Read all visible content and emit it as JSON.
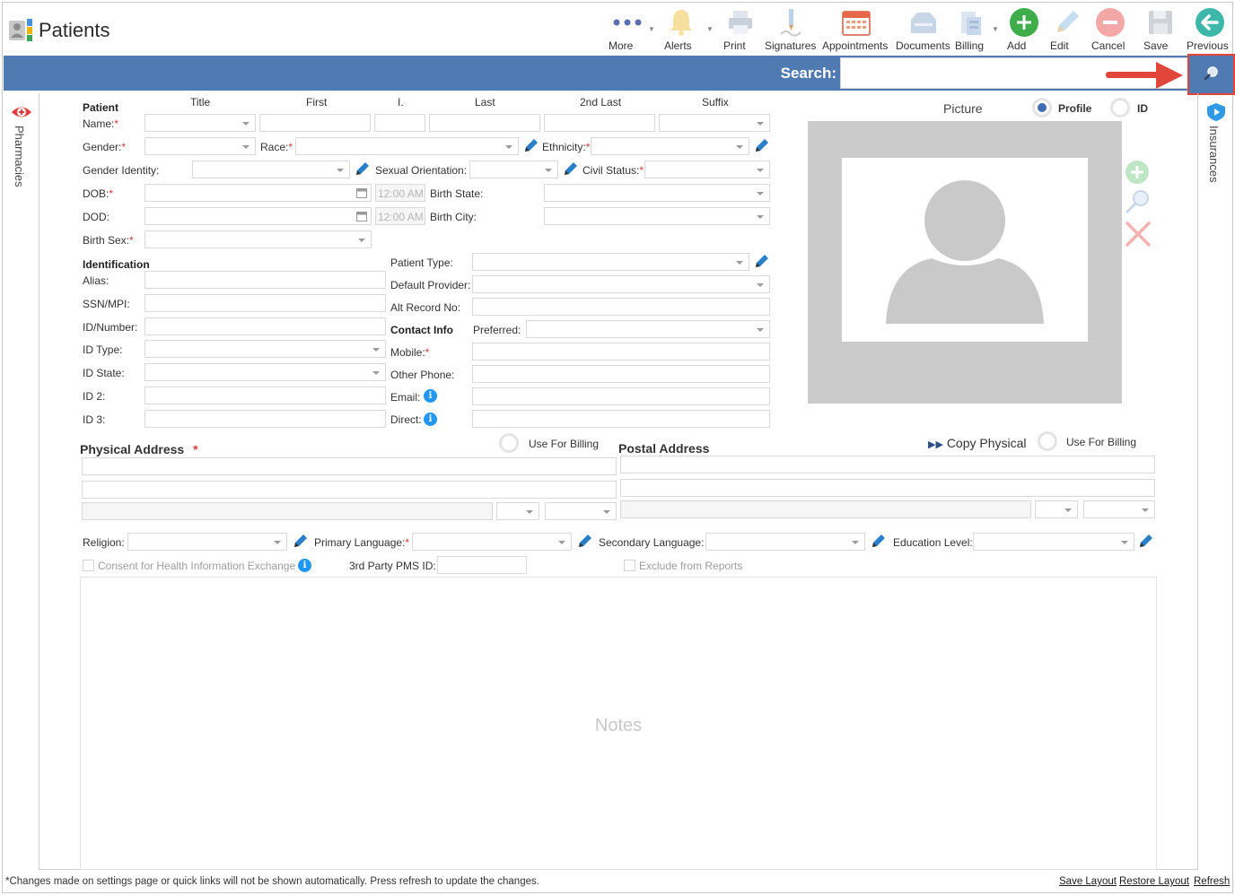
{
  "app": {
    "title": "Patients"
  },
  "toolbar": {
    "more": "More",
    "alerts": "Alerts",
    "print": "Print",
    "signatures": "Signatures",
    "appointments": "Appointments",
    "documents": "Documents",
    "billing": "Billing",
    "add": "Add",
    "edit": "Edit",
    "cancel": "Cancel",
    "save": "Save",
    "previous": "Previous"
  },
  "search": {
    "label": "Search:",
    "value": ""
  },
  "side": {
    "left_tab": "Pharmacies",
    "right_tab": "Insurances"
  },
  "patient": {
    "header": "Patient",
    "columns": {
      "title": "Title",
      "first": "First",
      "initial": "I.",
      "last": "Last",
      "second_last": "2nd Last",
      "suffix": "Suffix"
    },
    "name_label": "Name:",
    "gender_label": "Gender:",
    "race_label": "Race:",
    "ethnicity_label": "Ethnicity:",
    "gender_identity_label": "Gender Identity:",
    "sexual_orientation_label": "Sexual Orientation:",
    "civil_status_label": "Civil Status:",
    "dob_label": "DOB:",
    "dod_label": "DOD:",
    "birth_state_label": "Birth State:",
    "birth_city_label": "Birth City:",
    "birth_sex_label": "Birth Sex:",
    "dob_time": "12:00 AM",
    "dod_time": "12:00 AM"
  },
  "identification": {
    "header": "Identification",
    "alias": "Alias:",
    "ssn": "SSN/MPI:",
    "id_number": "ID/Number:",
    "id_type": "ID Type:",
    "id_state": "ID State:",
    "id2": "ID 2:",
    "id3": "ID 3:"
  },
  "other": {
    "patient_type": "Patient Type:",
    "default_provider": "Default Provider:",
    "alt_record": "Alt Record No:",
    "contact_info": "Contact Info",
    "preferred": "Preferred:",
    "mobile": "Mobile:",
    "other_phone": "Other Phone:",
    "email": "Email:",
    "direct": "Direct:"
  },
  "picture": {
    "label": "Picture",
    "profile": "Profile",
    "id": "ID"
  },
  "address": {
    "physical": "Physical Address",
    "postal": "Postal Address",
    "use_for_billing": "Use For Billing",
    "copy_physical": "Copy Physical"
  },
  "bottom": {
    "religion": "Religion:",
    "primary_language": "Primary Language:",
    "secondary_language": "Secondary Language:",
    "education_level": "Education Level:",
    "consent": "Consent for Health Information Exchange",
    "third_party": "3rd Party PMS ID:",
    "exclude": "Exclude from Reports"
  },
  "notes": {
    "placeholder": "Notes"
  },
  "footer": {
    "note": "*Changes made on settings page or quick links will not be shown automatically. Press refresh to update the changes.",
    "save_layout": "Save Layout",
    "restore_layout": "Restore Layout",
    "refresh": "Refresh"
  },
  "colors": {
    "accent": "#4f7ab2",
    "highlight": "#e2463a",
    "required": "#d43a3a",
    "info": "#2196f3"
  }
}
